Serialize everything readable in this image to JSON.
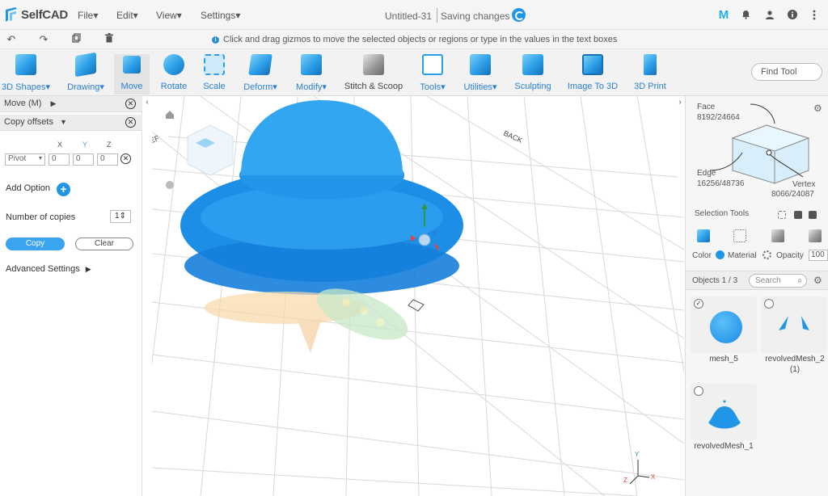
{
  "app": {
    "name": "SelfCAD",
    "menus": [
      "File▾",
      "Edit▾",
      "View▾",
      "Settings▾"
    ],
    "doc_title": "Untitled-31",
    "saving": "Saving changes",
    "user_initial": "M"
  },
  "hint": "Click and drag gizmos to move the selected objects or regions or type in the values in the text boxes",
  "toolbar": {
    "tools": [
      {
        "label": "3D Shapes▾",
        "icon": "cube-icon",
        "color": "blue"
      },
      {
        "label": "Drawing▾",
        "icon": "pen-icon",
        "color": "blue"
      },
      {
        "label": "Move",
        "icon": "move-icon",
        "color": "blue",
        "active": true
      },
      {
        "label": "Rotate",
        "icon": "rotate-icon",
        "color": "blue"
      },
      {
        "label": "Scale",
        "icon": "scale-icon",
        "color": "blue"
      },
      {
        "label": "Deform▾",
        "icon": "deform-icon",
        "color": "blue"
      },
      {
        "label": "Modify▾",
        "icon": "modify-icon",
        "color": "blue"
      },
      {
        "label": "Stitch & Scoop",
        "icon": "stitch-icon",
        "color": "grey"
      },
      {
        "label": "Tools▾",
        "icon": "tools-icon",
        "color": "blue"
      },
      {
        "label": "Utilities▾",
        "icon": "utilities-icon",
        "color": "blue"
      },
      {
        "label": "Sculpting",
        "icon": "sculpting-icon",
        "color": "blue"
      },
      {
        "label": "Image To 3D",
        "icon": "image-icon",
        "color": "blue"
      },
      {
        "label": "3D Print",
        "icon": "print-icon",
        "color": "blue"
      }
    ],
    "find_tool": "Find Tool"
  },
  "left_panel": {
    "move_title": "Move (M)",
    "copy_offsets": "Copy offsets",
    "axes": [
      "X",
      "Y",
      "Z"
    ],
    "pivot": "Pivot",
    "values": [
      "0",
      "0",
      "0"
    ],
    "add_option": "Add Option",
    "number_of_copies_label": "Number of copies",
    "number_of_copies": "1",
    "copy_button": "Copy",
    "clear_button": "Clear",
    "advanced": "Advanced Settings"
  },
  "viewport": {
    "labels": {
      "back": "BACK",
      "left": "LEF"
    },
    "axis_x": "X",
    "axis_y": "Y",
    "axis_z": "Z"
  },
  "right_panel": {
    "face_label": "Face",
    "face_count": "8192/24664",
    "edge_label": "Edge",
    "edge_count": "16256/48736",
    "vertex_label": "Vertex",
    "vertex_count": "8066/24087",
    "selection_tools": "Selection Tools",
    "color_label": "Color",
    "material_label": "Material",
    "opacity_label": "Opacity",
    "opacity_value": "100",
    "objects_label": "Objects 1 / 3",
    "search_placeholder": "Search",
    "objects": [
      {
        "name": "mesh_5",
        "checked": true
      },
      {
        "name": "revolvedMesh_2",
        "sub": "(1)"
      },
      {
        "name": "revolvedMesh_1"
      }
    ]
  },
  "colors": {
    "accent": "#2196e6",
    "object": "#1e8fe8"
  }
}
